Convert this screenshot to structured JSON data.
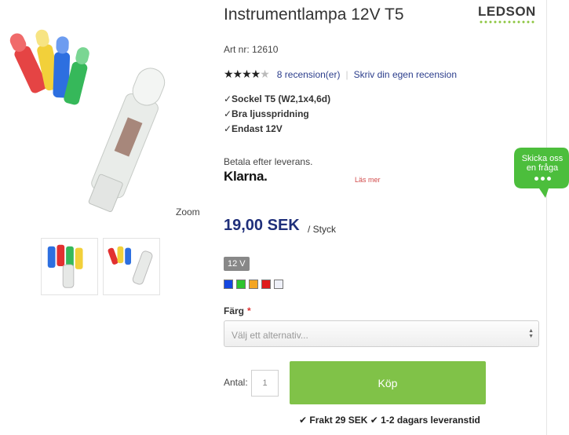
{
  "product": {
    "title": "Instrumentlampa 12V T5",
    "brand": "LEDSON",
    "article_number": "Art nr: 12610",
    "rating": {
      "stars": 4,
      "max": 5,
      "reviews_label": "8 recension(er)",
      "write_review_label": "Skriv din egen recension"
    },
    "features": [
      "✓Sockel T5 (W2,1x4,6d)",
      "✓Bra ljusspridning",
      "✓Endast 12V"
    ],
    "zoom_label": "Zoom"
  },
  "payment": {
    "text": "Betala efter leverans.",
    "provider": "Klarna.",
    "read_more": "Läs mer"
  },
  "chat": {
    "line1": "Skicka oss",
    "line2": "en fråga"
  },
  "price": {
    "amount": "19,00 SEK",
    "unit": "/ Styck"
  },
  "variants": {
    "voltage": "12 V",
    "colors": [
      {
        "name": "blue",
        "hex": "#1447e0"
      },
      {
        "name": "green",
        "hex": "#2ec42e"
      },
      {
        "name": "amber",
        "hex": "#f4a623"
      },
      {
        "name": "red",
        "hex": "#e01b1b"
      },
      {
        "name": "white",
        "hex": "#eef0f8"
      }
    ]
  },
  "color_select": {
    "label": "Färg",
    "required_mark": "*",
    "placeholder": "Välj ett alternativ..."
  },
  "quantity": {
    "label": "Antal:",
    "value": "1"
  },
  "buy_button": "Köp",
  "shipping": "✔ Frakt 29 SEK ✔ 1-2 dagars leveranstid",
  "colors": {
    "price": "#1f2f7a",
    "buy": "#80c248",
    "link": "#2c3e8c",
    "chat": "#4cbe3c"
  }
}
